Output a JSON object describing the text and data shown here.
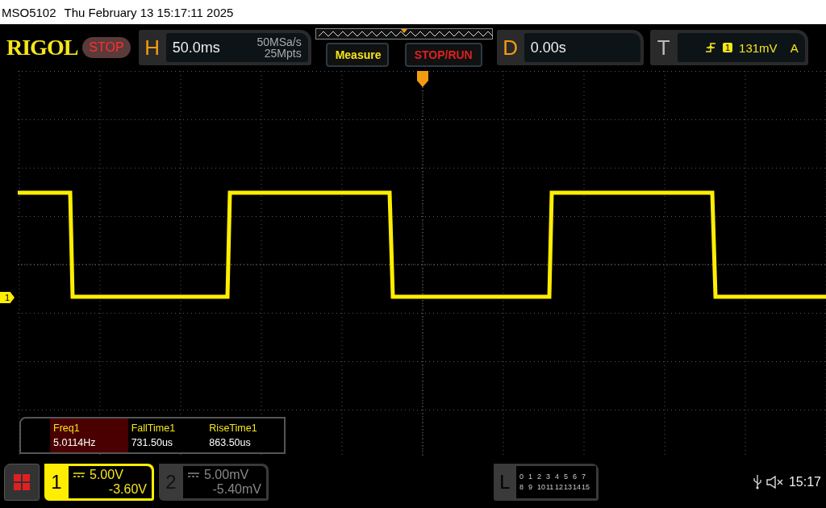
{
  "title_bar": {
    "model": "MSO5102",
    "datetime": "Thu February 13 15:17:11 2025"
  },
  "header": {
    "logo": "RIGOL",
    "run_state": "STOP",
    "horizontal": {
      "label": "H",
      "timebase": "50.0ms",
      "sample_rate": "50MSa/s",
      "memory_depth": "25Mpts"
    },
    "measure_button": "Measure",
    "stop_run_button": "STOP/RUN",
    "delay": {
      "label": "D",
      "value": "0.00s"
    },
    "trigger": {
      "label": "T",
      "source": "1",
      "threshold": "131mV",
      "mode": "A"
    }
  },
  "waveform": {
    "channel_marker": "1"
  },
  "measurements": [
    {
      "name": "Freq1",
      "value": "5.0114Hz",
      "selected": true
    },
    {
      "name": "FallTime1",
      "value": "731.50us",
      "selected": false
    },
    {
      "name": "RiseTime1",
      "value": "863.50us",
      "selected": false
    }
  ],
  "bottom_bar": {
    "channels": [
      {
        "number": "1",
        "scale": "5.00V",
        "offset": "-3.60V",
        "on": true
      },
      {
        "number": "2",
        "scale": "5.00mV",
        "offset": "-5.40mV",
        "on": false
      }
    ],
    "logic": {
      "label": "L",
      "rows": [
        [
          "0",
          "1",
          "2",
          "3",
          "4",
          "5",
          "6",
          "7"
        ],
        [
          "8",
          "9",
          "10",
          "11",
          "12",
          "13",
          "14",
          "15"
        ]
      ]
    },
    "time": "15:17"
  }
}
